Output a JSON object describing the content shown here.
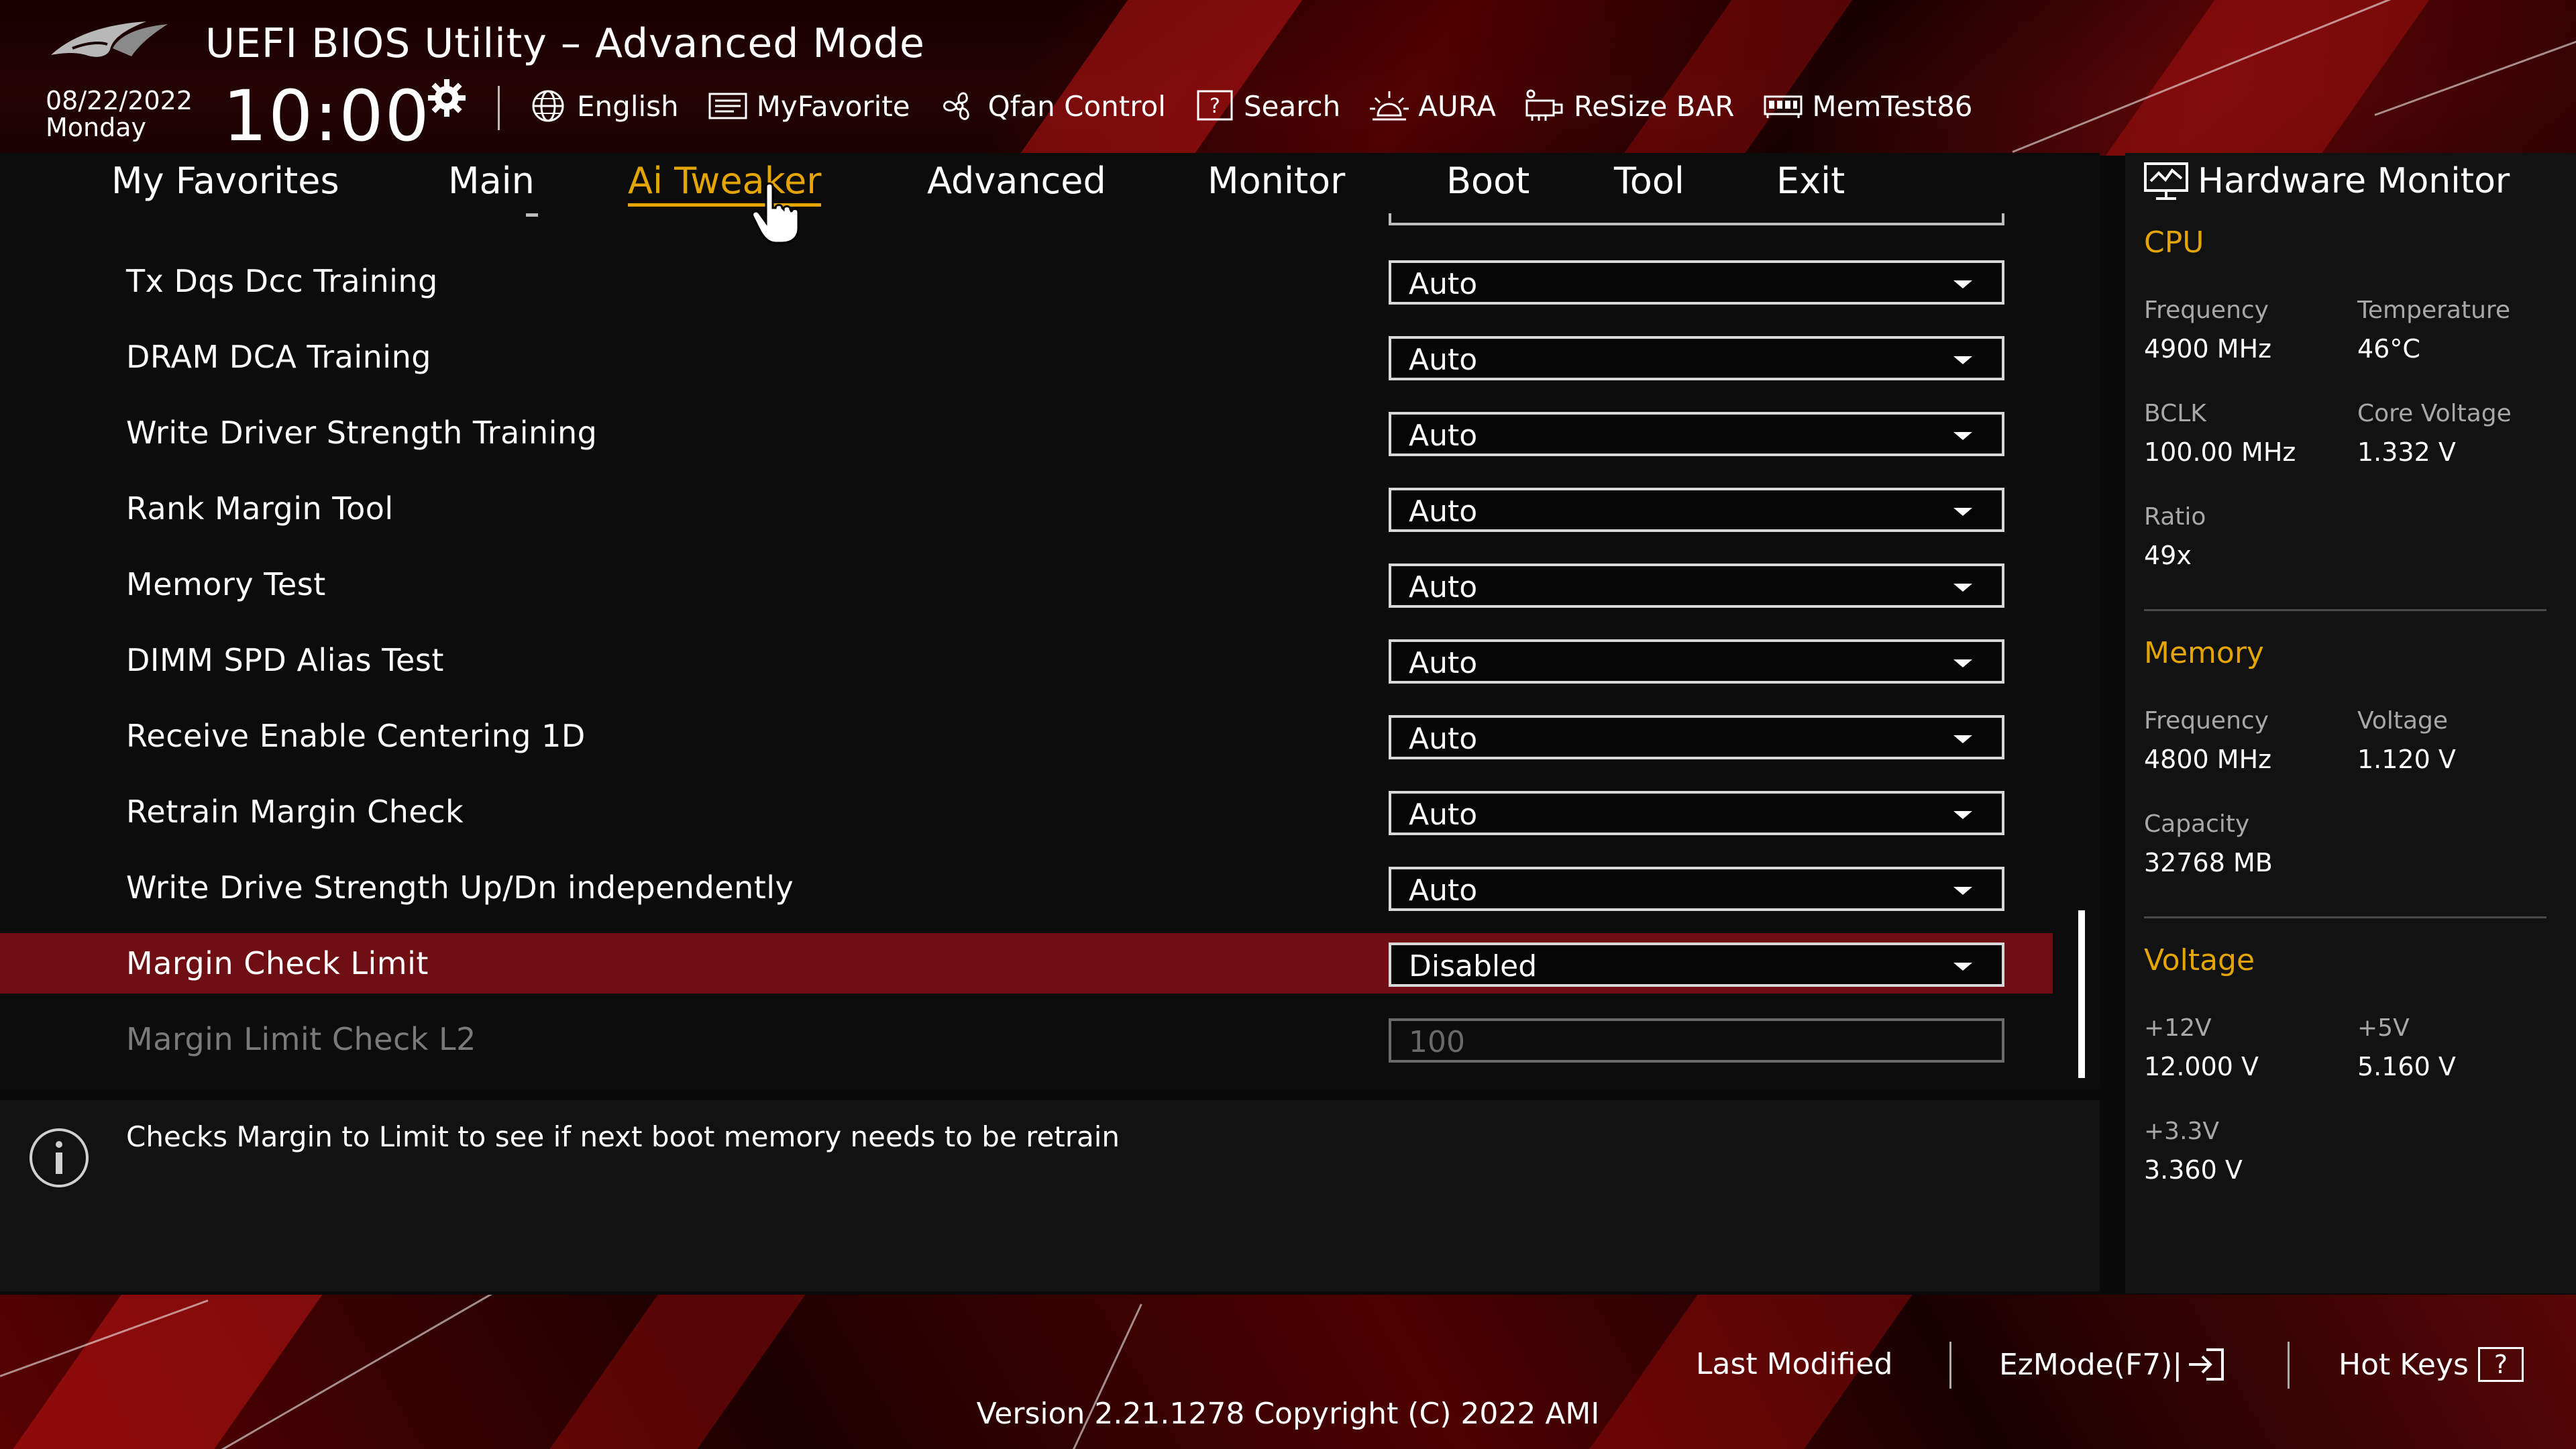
{
  "header": {
    "title": "UEFI BIOS Utility – Advanced Mode",
    "date": "08/22/2022",
    "day": "Monday",
    "time": "10:00"
  },
  "toolbar": {
    "english": "English",
    "myfavorite": "MyFavorite",
    "qfan": "Qfan Control",
    "search": "Search",
    "aura": "AURA",
    "resizebar": "ReSize BAR",
    "memtest": "MemTest86"
  },
  "tabs": {
    "favorites": "My Favorites",
    "main": "Main",
    "ai_tweaker": "Ai Tweaker",
    "advanced": "Advanced",
    "monitor": "Monitor",
    "boot": "Boot",
    "tool": "Tool",
    "exit": "Exit",
    "active": "Ai Tweaker"
  },
  "settings": [
    {
      "label": "Tx Dqs Dcc Training",
      "value": "Auto"
    },
    {
      "label": "DRAM DCA Training",
      "value": "Auto"
    },
    {
      "label": "Write Driver Strength Training",
      "value": "Auto"
    },
    {
      "label": "Rank Margin Tool",
      "value": "Auto"
    },
    {
      "label": "Memory Test",
      "value": "Auto"
    },
    {
      "label": "DIMM SPD Alias Test",
      "value": "Auto"
    },
    {
      "label": "Receive Enable Centering 1D",
      "value": "Auto"
    },
    {
      "label": "Retrain Margin Check",
      "value": "Auto"
    },
    {
      "label": "Write Drive Strength Up/Dn independently",
      "value": "Auto"
    },
    {
      "label": "Margin Check Limit",
      "value": "Disabled"
    },
    {
      "label": "Margin Limit Check L2",
      "value": "100"
    }
  ],
  "help": {
    "text": "Checks Margin to Limit to see if next boot memory needs to be retrain"
  },
  "hw_monitor": {
    "title": "Hardware Monitor",
    "cpu": {
      "heading": "CPU",
      "frequency_label": "Frequency",
      "frequency": "4900 MHz",
      "temperature_label": "Temperature",
      "temperature": "46°C",
      "bclk_label": "BCLK",
      "bclk": "100.00 MHz",
      "core_voltage_label": "Core Voltage",
      "core_voltage": "1.332 V",
      "ratio_label": "Ratio",
      "ratio": "49x"
    },
    "memory": {
      "heading": "Memory",
      "frequency_label": "Frequency",
      "frequency": "4800 MHz",
      "voltage_label": "Voltage",
      "voltage": "1.120 V",
      "capacity_label": "Capacity",
      "capacity": "32768 MB"
    },
    "voltage": {
      "heading": "Voltage",
      "v12_label": "+12V",
      "v12": "12.000 V",
      "v5_label": "+5V",
      "v5": "5.160 V",
      "v33_label": "+3.3V",
      "v33": "3.360 V"
    }
  },
  "footer": {
    "last_modified": "Last Modified",
    "ezmode": "EzMode(F7)|",
    "hotkeys": "Hot Keys",
    "hotkeys_key": "?",
    "version": "Version 2.21.1278 Copyright (C) 2022 AMI"
  },
  "colors": {
    "accent": "#e5a500",
    "selected_row": "#6f0f14",
    "background": "#0c0c0c"
  }
}
